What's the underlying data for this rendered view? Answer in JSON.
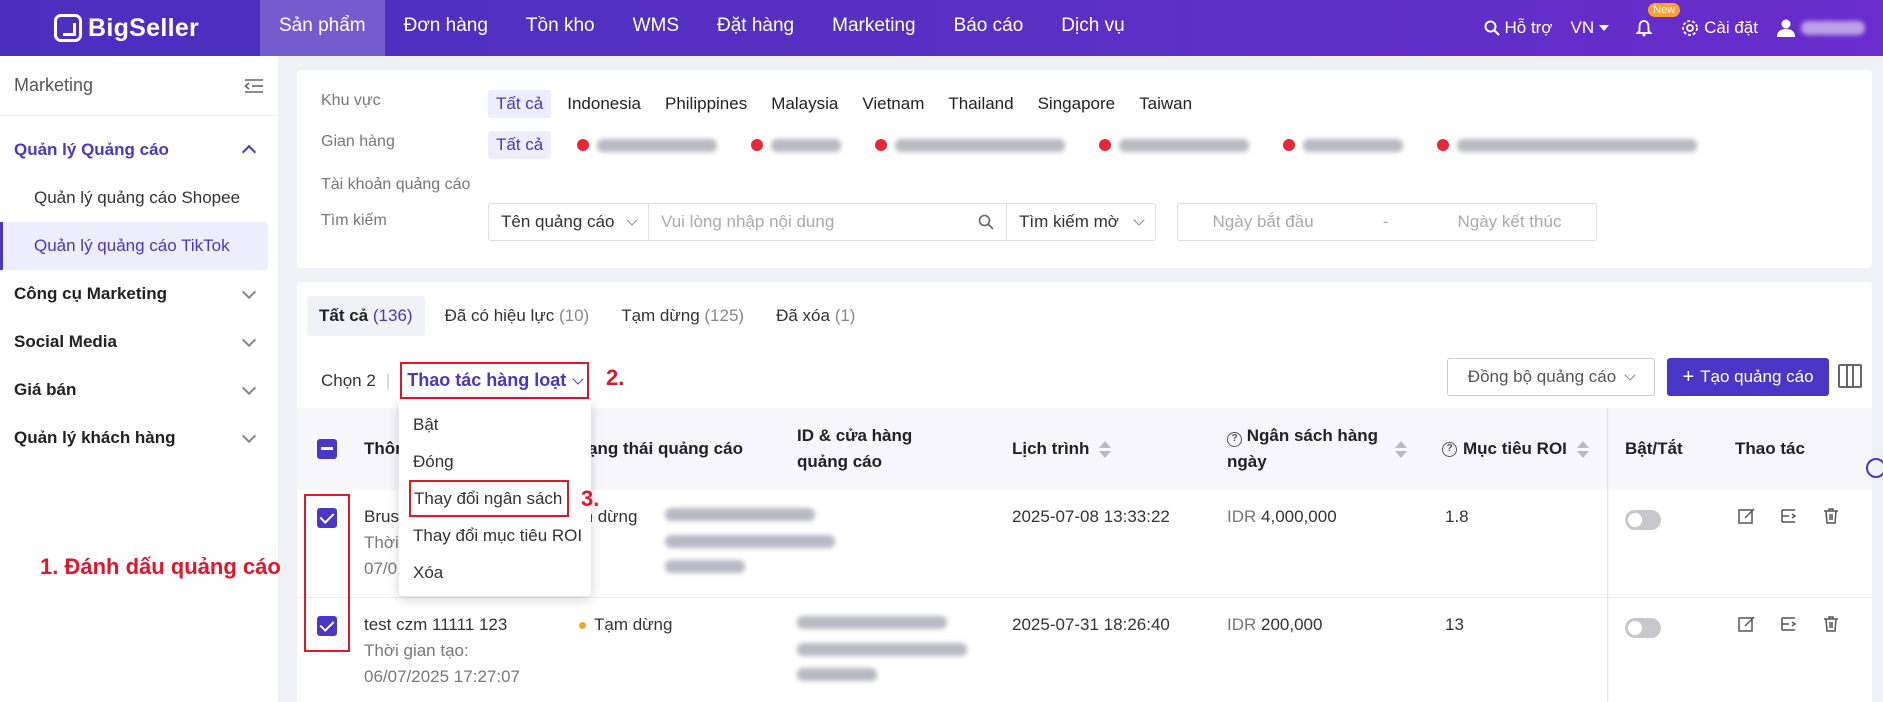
{
  "brand": {
    "name": "BigSeller",
    "accent": "#4a36c7",
    "annotation_color": "#e0162b"
  },
  "topnav": {
    "items": [
      "Sản phẩm",
      "Đơn hàng",
      "Tồn kho",
      "WMS",
      "Đặt hàng",
      "Marketing",
      "Báo cáo",
      "Dịch vụ"
    ],
    "active_index": 0,
    "support": "Hỗ trợ",
    "language": "VN",
    "new_badge": "New",
    "settings": "Cài đặt"
  },
  "sidebar": {
    "title": "Marketing",
    "groups": [
      {
        "label": "Quản lý Quảng cáo",
        "open": true,
        "children": [
          "Quản lý quảng cáo Shopee",
          "Quản lý quảng cáo TikTok"
        ],
        "active_child": 1
      },
      {
        "label": "Công cụ Marketing",
        "open": false
      },
      {
        "label": "Social Media",
        "open": false
      },
      {
        "label": "Giá bán",
        "open": false
      },
      {
        "label": "Quản lý khách hàng",
        "open": false
      }
    ]
  },
  "filters": {
    "region_label": "Khu vực",
    "regions": [
      "Tất cả",
      "Indonesia",
      "Philippines",
      "Malaysia",
      "Vietnam",
      "Thailand",
      "Singapore",
      "Taiwan"
    ],
    "store_label": "Gian hàng",
    "store_all": "Tất cả",
    "ad_account_label": "Tài khoản quảng cáo",
    "search_label": "Tìm kiếm",
    "search_field": "Tên quảng cáo",
    "search_placeholder": "Vui lòng nhập nội dung",
    "search_mode": "Tìm kiếm mờ",
    "date_start": "Ngày bắt đầu",
    "date_sep": "-",
    "date_end": "Ngày kết thúc"
  },
  "tabs": [
    {
      "label": "Tất cả",
      "count": "(136)"
    },
    {
      "label": "Đã có hiệu lực",
      "count": "(10)"
    },
    {
      "label": "Tạm dừng",
      "count": "(125)"
    },
    {
      "label": "Đã xóa",
      "count": "(1)"
    }
  ],
  "toolbar": {
    "selected": "Chọn 2",
    "batch": "Thao tác hàng loạt",
    "sync": "Đồng bộ quảng cáo",
    "create": "Tạo quảng cáo"
  },
  "batch_menu": [
    "Bật",
    "Đóng",
    "Thay đổi ngân sách",
    "Thay đổi mục tiêu ROI",
    "Xóa"
  ],
  "table": {
    "columns": [
      "Thông tin quảng cáo",
      "Trạng thái quảng cáo",
      "ID & cửa hàng quảng cáo",
      "Lịch trình",
      "Ngân sách hàng ngày",
      "Mục tiêu ROI",
      "Bật/Tắt",
      "Thao tác"
    ],
    "rows": [
      {
        "name": "Brus",
        "created_label": "Thời",
        "created_time": "07/0",
        "status": "Tạm dừng",
        "schedule": "2025-07-08 13:33:22",
        "currency": "IDR",
        "budget": "4,000,000",
        "roi": "1.8"
      },
      {
        "name": "test czm 11111 123",
        "created_label": "Thời gian tạo:",
        "created_time": "06/07/2025 17:27:07",
        "status": "Tạm dừng",
        "schedule": "2025-07-31 18:26:40",
        "currency": "IDR",
        "budget": "200,000",
        "roi": "13"
      }
    ]
  },
  "annotations": {
    "step1": "1. Đánh dấu quảng cáo",
    "step2": "2.",
    "step3": "3."
  }
}
